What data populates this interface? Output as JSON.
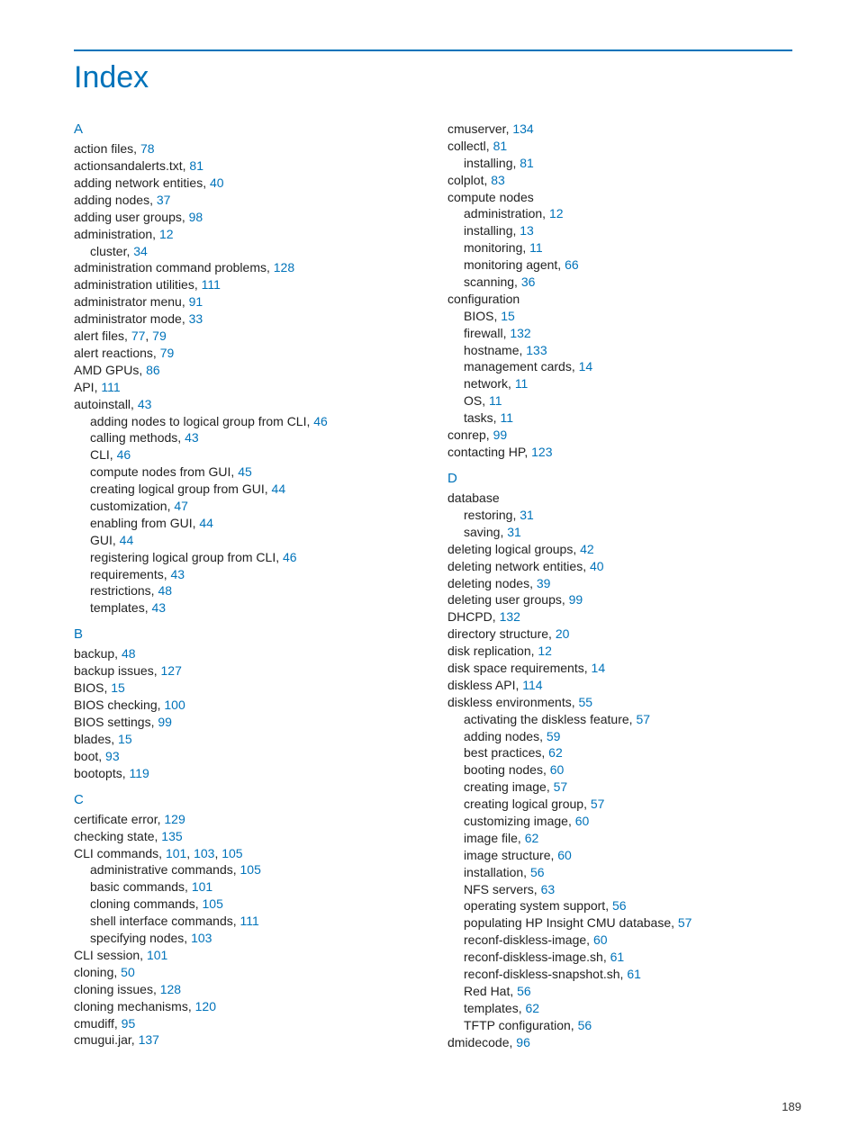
{
  "title": "Index",
  "page_number": "189",
  "col1": [
    {
      "type": "letter",
      "text": "A",
      "first": true
    },
    {
      "type": "entry",
      "label": "action files, ",
      "pages": [
        "78"
      ]
    },
    {
      "type": "entry",
      "label": "actionsandalerts.txt, ",
      "pages": [
        "81"
      ]
    },
    {
      "type": "entry",
      "label": "adding network entities, ",
      "pages": [
        "40"
      ]
    },
    {
      "type": "entry",
      "label": "adding nodes, ",
      "pages": [
        "37"
      ]
    },
    {
      "type": "entry",
      "label": "adding user groups, ",
      "pages": [
        "98"
      ]
    },
    {
      "type": "entry",
      "label": "administration, ",
      "pages": [
        "12"
      ]
    },
    {
      "type": "sub",
      "label": "cluster, ",
      "pages": [
        "34"
      ]
    },
    {
      "type": "entry",
      "label": "administration command problems, ",
      "pages": [
        "128"
      ]
    },
    {
      "type": "entry",
      "label": "administration utilities, ",
      "pages": [
        "111"
      ]
    },
    {
      "type": "entry",
      "label": "administrator menu, ",
      "pages": [
        "91"
      ]
    },
    {
      "type": "entry",
      "label": "administrator mode, ",
      "pages": [
        "33"
      ]
    },
    {
      "type": "entry",
      "label": "alert files, ",
      "pages": [
        "77",
        "79"
      ]
    },
    {
      "type": "entry",
      "label": "alert reactions, ",
      "pages": [
        "79"
      ]
    },
    {
      "type": "entry",
      "label": "AMD GPUs, ",
      "pages": [
        "86"
      ]
    },
    {
      "type": "entry",
      "label": "API, ",
      "pages": [
        "111"
      ]
    },
    {
      "type": "entry",
      "label": "autoinstall, ",
      "pages": [
        "43"
      ]
    },
    {
      "type": "sub",
      "label": "adding nodes to logical group from CLI, ",
      "pages": [
        "46"
      ]
    },
    {
      "type": "sub",
      "label": "calling methods, ",
      "pages": [
        "43"
      ]
    },
    {
      "type": "sub",
      "label": "CLI, ",
      "pages": [
        "46"
      ]
    },
    {
      "type": "sub",
      "label": "compute nodes from GUI, ",
      "pages": [
        "45"
      ]
    },
    {
      "type": "sub",
      "label": "creating logical group from GUI, ",
      "pages": [
        "44"
      ]
    },
    {
      "type": "sub",
      "label": "customization, ",
      "pages": [
        "47"
      ]
    },
    {
      "type": "sub",
      "label": "enabling from GUI, ",
      "pages": [
        "44"
      ]
    },
    {
      "type": "sub",
      "label": "GUI, ",
      "pages": [
        "44"
      ]
    },
    {
      "type": "sub",
      "label": "registering logical group from CLI, ",
      "pages": [
        "46"
      ]
    },
    {
      "type": "sub",
      "label": "requirements, ",
      "pages": [
        "43"
      ]
    },
    {
      "type": "sub",
      "label": "restrictions, ",
      "pages": [
        "48"
      ]
    },
    {
      "type": "sub",
      "label": "templates, ",
      "pages": [
        "43"
      ]
    },
    {
      "type": "letter",
      "text": "B"
    },
    {
      "type": "entry",
      "label": "backup, ",
      "pages": [
        "48"
      ]
    },
    {
      "type": "entry",
      "label": "backup issues, ",
      "pages": [
        "127"
      ]
    },
    {
      "type": "entry",
      "label": "BIOS, ",
      "pages": [
        "15"
      ]
    },
    {
      "type": "entry",
      "label": "BIOS checking, ",
      "pages": [
        "100"
      ]
    },
    {
      "type": "entry",
      "label": "BIOS settings, ",
      "pages": [
        "99"
      ]
    },
    {
      "type": "entry",
      "label": "blades, ",
      "pages": [
        "15"
      ]
    },
    {
      "type": "entry",
      "label": "boot, ",
      "pages": [
        "93"
      ]
    },
    {
      "type": "entry",
      "label": "bootopts, ",
      "pages": [
        "119"
      ]
    },
    {
      "type": "letter",
      "text": "C"
    },
    {
      "type": "entry",
      "label": "certificate error, ",
      "pages": [
        "129"
      ]
    },
    {
      "type": "entry",
      "label": "checking state, ",
      "pages": [
        "135"
      ]
    },
    {
      "type": "entry",
      "label": "CLI commands, ",
      "pages": [
        "101",
        "103",
        "105"
      ]
    },
    {
      "type": "sub",
      "label": "administrative commands, ",
      "pages": [
        "105"
      ]
    },
    {
      "type": "sub",
      "label": "basic commands, ",
      "pages": [
        "101"
      ]
    },
    {
      "type": "sub",
      "label": "cloning commands, ",
      "pages": [
        "105"
      ]
    },
    {
      "type": "sub",
      "label": "shell interface commands, ",
      "pages": [
        "111"
      ]
    },
    {
      "type": "sub",
      "label": "specifying nodes, ",
      "pages": [
        "103"
      ]
    },
    {
      "type": "entry",
      "label": "CLI session, ",
      "pages": [
        "101"
      ]
    },
    {
      "type": "entry",
      "label": "cloning, ",
      "pages": [
        "50"
      ]
    },
    {
      "type": "entry",
      "label": "cloning issues, ",
      "pages": [
        "128"
      ]
    },
    {
      "type": "entry",
      "label": "cloning mechanisms, ",
      "pages": [
        "120"
      ]
    },
    {
      "type": "entry",
      "label": "cmudiff, ",
      "pages": [
        "95"
      ]
    },
    {
      "type": "entry",
      "label": "cmugui.jar, ",
      "pages": [
        "137"
      ]
    }
  ],
  "col2": [
    {
      "type": "entry",
      "label": "cmuserver, ",
      "pages": [
        "134"
      ]
    },
    {
      "type": "entry",
      "label": "collectl, ",
      "pages": [
        "81"
      ]
    },
    {
      "type": "sub",
      "label": "installing, ",
      "pages": [
        "81"
      ]
    },
    {
      "type": "entry",
      "label": "colplot, ",
      "pages": [
        "83"
      ]
    },
    {
      "type": "entry",
      "label": "compute nodes",
      "pages": []
    },
    {
      "type": "sub",
      "label": "administration, ",
      "pages": [
        "12"
      ]
    },
    {
      "type": "sub",
      "label": "installing, ",
      "pages": [
        "13"
      ]
    },
    {
      "type": "sub",
      "label": "monitoring, ",
      "pages": [
        "11"
      ]
    },
    {
      "type": "sub",
      "label": "monitoring agent, ",
      "pages": [
        "66"
      ]
    },
    {
      "type": "sub",
      "label": "scanning, ",
      "pages": [
        "36"
      ]
    },
    {
      "type": "entry",
      "label": "configuration",
      "pages": []
    },
    {
      "type": "sub",
      "label": "BIOS, ",
      "pages": [
        "15"
      ]
    },
    {
      "type": "sub",
      "label": "firewall, ",
      "pages": [
        "132"
      ]
    },
    {
      "type": "sub",
      "label": "hostname, ",
      "pages": [
        "133"
      ]
    },
    {
      "type": "sub",
      "label": "management cards, ",
      "pages": [
        "14"
      ]
    },
    {
      "type": "sub",
      "label": "network, ",
      "pages": [
        "11"
      ]
    },
    {
      "type": "sub",
      "label": "OS, ",
      "pages": [
        "11"
      ]
    },
    {
      "type": "sub",
      "label": "tasks, ",
      "pages": [
        "11"
      ]
    },
    {
      "type": "entry",
      "label": "conrep, ",
      "pages": [
        "99"
      ]
    },
    {
      "type": "entry",
      "label": "contacting HP, ",
      "pages": [
        "123"
      ]
    },
    {
      "type": "letter",
      "text": "D"
    },
    {
      "type": "entry",
      "label": "database",
      "pages": []
    },
    {
      "type": "sub",
      "label": "restoring, ",
      "pages": [
        "31"
      ]
    },
    {
      "type": "sub",
      "label": "saving, ",
      "pages": [
        "31"
      ]
    },
    {
      "type": "entry",
      "label": "deleting logical groups, ",
      "pages": [
        "42"
      ]
    },
    {
      "type": "entry",
      "label": "deleting network entities, ",
      "pages": [
        "40"
      ]
    },
    {
      "type": "entry",
      "label": "deleting nodes, ",
      "pages": [
        "39"
      ]
    },
    {
      "type": "entry",
      "label": "deleting user groups, ",
      "pages": [
        "99"
      ]
    },
    {
      "type": "entry",
      "label": "DHCPD, ",
      "pages": [
        "132"
      ]
    },
    {
      "type": "entry",
      "label": "directory structure, ",
      "pages": [
        "20"
      ]
    },
    {
      "type": "entry",
      "label": "disk replication, ",
      "pages": [
        "12"
      ]
    },
    {
      "type": "entry",
      "label": "disk space requirements, ",
      "pages": [
        "14"
      ]
    },
    {
      "type": "entry",
      "label": "diskless API, ",
      "pages": [
        "114"
      ]
    },
    {
      "type": "entry",
      "label": "diskless environments, ",
      "pages": [
        "55"
      ]
    },
    {
      "type": "sub",
      "label": "activating the diskless feature, ",
      "pages": [
        "57"
      ]
    },
    {
      "type": "sub",
      "label": "adding nodes, ",
      "pages": [
        "59"
      ]
    },
    {
      "type": "sub",
      "label": "best practices, ",
      "pages": [
        "62"
      ]
    },
    {
      "type": "sub",
      "label": "booting nodes, ",
      "pages": [
        "60"
      ]
    },
    {
      "type": "sub",
      "label": "creating image, ",
      "pages": [
        "57"
      ]
    },
    {
      "type": "sub",
      "label": "creating logical group, ",
      "pages": [
        "57"
      ]
    },
    {
      "type": "sub",
      "label": "customizing image, ",
      "pages": [
        "60"
      ]
    },
    {
      "type": "sub",
      "label": "image file, ",
      "pages": [
        "62"
      ]
    },
    {
      "type": "sub",
      "label": "image structure, ",
      "pages": [
        "60"
      ]
    },
    {
      "type": "sub",
      "label": "installation, ",
      "pages": [
        "56"
      ]
    },
    {
      "type": "sub",
      "label": "NFS servers, ",
      "pages": [
        "63"
      ]
    },
    {
      "type": "sub",
      "label": "operating system support, ",
      "pages": [
        "56"
      ]
    },
    {
      "type": "sub",
      "label": "populating HP Insight CMU database, ",
      "pages": [
        "57"
      ]
    },
    {
      "type": "sub",
      "label": "reconf-diskless-image, ",
      "pages": [
        "60"
      ]
    },
    {
      "type": "sub",
      "label": "reconf-diskless-image.sh, ",
      "pages": [
        "61"
      ]
    },
    {
      "type": "sub",
      "label": "reconf-diskless-snapshot.sh, ",
      "pages": [
        "61"
      ]
    },
    {
      "type": "sub",
      "label": "Red Hat, ",
      "pages": [
        "56"
      ]
    },
    {
      "type": "sub",
      "label": "templates, ",
      "pages": [
        "62"
      ]
    },
    {
      "type": "sub",
      "label": "TFTP configuration, ",
      "pages": [
        "56"
      ]
    },
    {
      "type": "entry",
      "label": "dmidecode, ",
      "pages": [
        "96"
      ]
    }
  ]
}
